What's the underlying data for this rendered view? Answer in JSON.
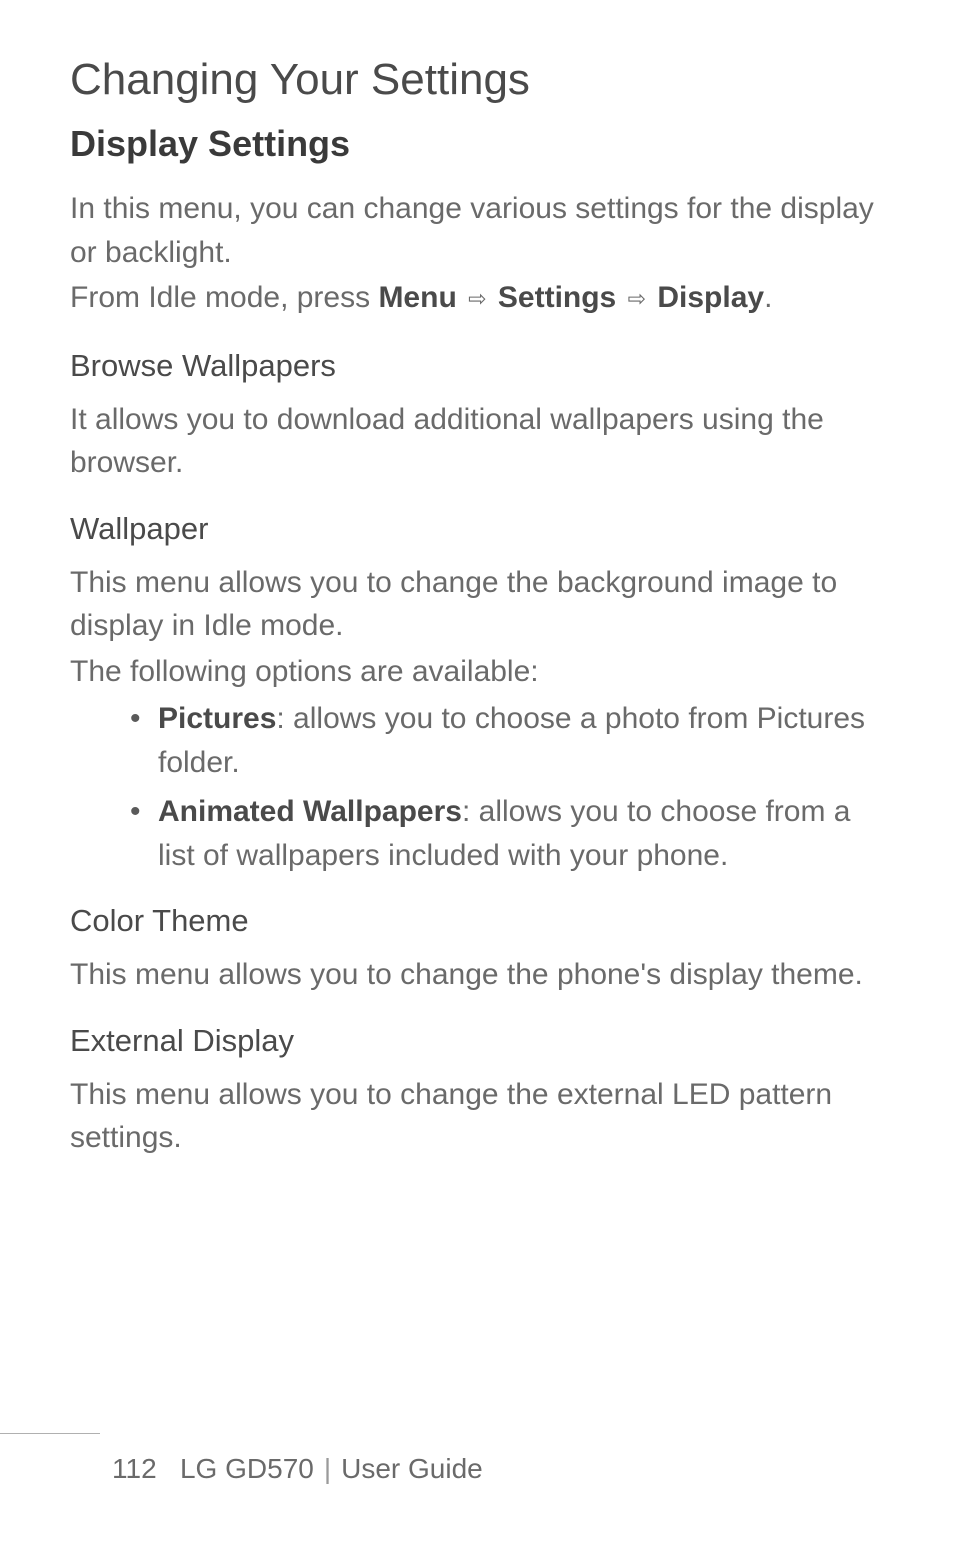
{
  "page": {
    "title": "Changing Your Settings",
    "sectionTitle": "Display Settings",
    "intro1": "In this menu, you can change various settings for the display or backlight.",
    "navPrefix": "From Idle mode, press ",
    "navMenu": "Menu",
    "navSettings": "Settings",
    "navDisplay": "Display"
  },
  "subsections": {
    "browseWallpapers": {
      "title": "Browse Wallpapers",
      "text": "It allows you to download additional wallpapers using the browser."
    },
    "wallpaper": {
      "title": "Wallpaper",
      "text1": "This menu allows you to change the background image to display in Idle mode.",
      "text2": "The following options are available:",
      "bullets": {
        "picturesLabel": "Pictures",
        "picturesText": ": allows you to choose a photo from Pictures folder.",
        "animatedLabel": "Animated Wallpapers",
        "animatedText": ": allows you to choose from a list of wallpapers included with your phone."
      }
    },
    "colorTheme": {
      "title": "Color Theme",
      "text": "This menu allows you to change the phone's display theme."
    },
    "externalDisplay": {
      "title": "External Display",
      "text": "This menu allows you to change the external LED pattern settings."
    }
  },
  "footer": {
    "pageNumber": "112",
    "model": "LG GD570",
    "guide": "User Guide"
  }
}
